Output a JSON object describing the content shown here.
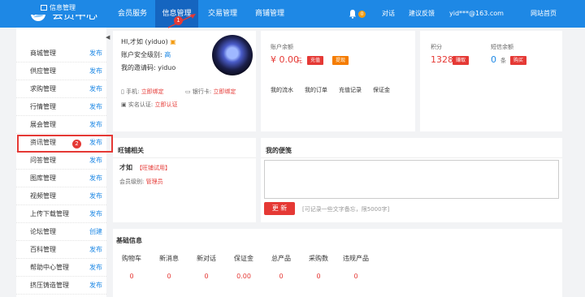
{
  "header": {
    "logo_text": "会员中心",
    "nav": [
      "会员服务",
      "信息管理",
      "交易管理",
      "商铺管理"
    ],
    "notification_count": "0",
    "links": {
      "chat": "对话",
      "feedback": "建议反馈",
      "email": "yid***@163.com",
      "home": "网站首页"
    }
  },
  "sidebar": {
    "title": "信息管理",
    "items": [
      {
        "label": "商城管理",
        "action": "发布"
      },
      {
        "label": "供应管理",
        "action": "发布"
      },
      {
        "label": "求购管理",
        "action": "发布"
      },
      {
        "label": "行情管理",
        "action": "发布"
      },
      {
        "label": "展会管理",
        "action": "发布"
      },
      {
        "label": "资讯管理",
        "action": "发布"
      },
      {
        "label": "问答管理",
        "action": "发布"
      },
      {
        "label": "图库管理",
        "action": "发布"
      },
      {
        "label": "视频管理",
        "action": "发布"
      },
      {
        "label": "上传下载管理",
        "action": "发布"
      },
      {
        "label": "论坛管理",
        "action": "创建"
      },
      {
        "label": "百科管理",
        "action": "发布"
      },
      {
        "label": "帮助中心管理",
        "action": "发布"
      },
      {
        "label": "挤压铸造管理",
        "action": "发布"
      }
    ]
  },
  "annotations": {
    "step1": "1",
    "step2": "2"
  },
  "profile": {
    "greeting": "HI,才如 (yiduo)",
    "security_label": "账户安全级别:",
    "security_value": "高",
    "invite_label": "我的邀请码:",
    "invite_code": "yiduo",
    "phone_label": "手机:",
    "phone_link": "立即绑定",
    "bank_label": "银行卡:",
    "bank_link": "立即绑定",
    "realname_label": "实名认证:",
    "realname_link": "立即认证"
  },
  "balance": {
    "title": "账户余额",
    "amount": "¥ 0.00",
    "unit": "元",
    "recharge": "充值",
    "withdraw": "提现",
    "links": [
      "我的流水",
      "我的订单",
      "充值记录",
      "保证金"
    ]
  },
  "points": {
    "points_label": "积分",
    "points_value": "1328",
    "points_btn": "赚取",
    "sms_label": "短信余额",
    "sms_value": "0",
    "sms_unit": "条",
    "sms_btn": "购买"
  },
  "shop": {
    "title": "旺铺相关",
    "name": "才如",
    "tag": "【旺铺试用】",
    "level_label": "会员级别:",
    "level_value": "管理员"
  },
  "memo": {
    "title": "我的便笺",
    "button": "更 新",
    "hint": "[可记录一些文字备忘，限5000字]"
  },
  "basic": {
    "title": "基础信息",
    "headers": [
      "购物车",
      "新消息",
      "新对话",
      "保证金",
      "总产品",
      "采购数",
      "违规产品"
    ],
    "values": [
      "0",
      "0",
      "0",
      "0.00",
      "0",
      "0",
      "0"
    ]
  },
  "colors": {
    "primary": "#1e88e5",
    "active": "#1565c0",
    "danger": "#e53935",
    "orange": "#f39c12"
  }
}
